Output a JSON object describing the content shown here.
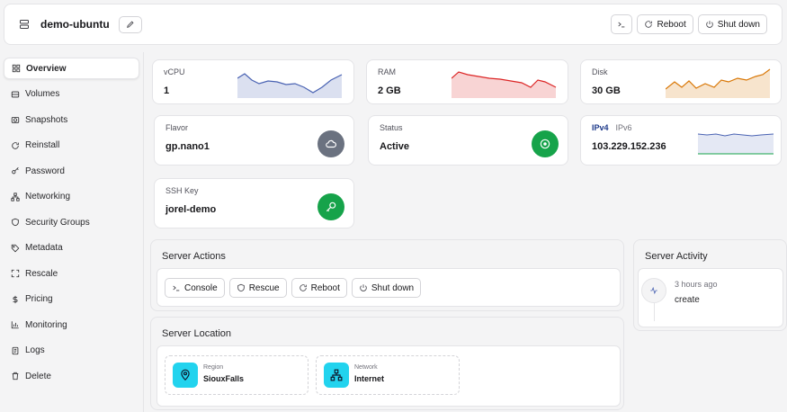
{
  "header": {
    "server_name": "demo-ubuntu",
    "reboot_label": "Reboot",
    "shutdown_label": "Shut down"
  },
  "sidebar": {
    "items": [
      {
        "label": "Overview",
        "icon": "grid-icon"
      },
      {
        "label": "Volumes",
        "icon": "disk-icon"
      },
      {
        "label": "Snapshots",
        "icon": "camera-icon"
      },
      {
        "label": "Reinstall",
        "icon": "refresh-icon"
      },
      {
        "label": "Password",
        "icon": "key-icon"
      },
      {
        "label": "Networking",
        "icon": "network-icon"
      },
      {
        "label": "Security Groups",
        "icon": "shield-icon"
      },
      {
        "label": "Metadata",
        "icon": "tag-icon"
      },
      {
        "label": "Rescale",
        "icon": "scale-icon"
      },
      {
        "label": "Pricing",
        "icon": "dollar-icon"
      },
      {
        "label": "Monitoring",
        "icon": "chart-icon"
      },
      {
        "label": "Logs",
        "icon": "log-icon"
      },
      {
        "label": "Delete",
        "icon": "trash-icon"
      }
    ]
  },
  "metrics": {
    "vcpu": {
      "label": "vCPU",
      "value": "1",
      "color": "#4a63b3"
    },
    "ram": {
      "label": "RAM",
      "value": "2 GB",
      "color": "#dc2626"
    },
    "disk": {
      "label": "Disk",
      "value": "30 GB",
      "color": "#d97706"
    }
  },
  "info": {
    "flavor": {
      "label": "Flavor",
      "value": "gp.nano1"
    },
    "status": {
      "label": "Status",
      "value": "Active"
    },
    "ip": {
      "tab_v4": "IPv4",
      "tab_v6": "IPv6",
      "value": "103.229.152.236"
    },
    "ssh": {
      "label": "SSH Key",
      "value": "jorel-demo"
    }
  },
  "actions": {
    "title": "Server Actions",
    "buttons": [
      "Console",
      "Rescue",
      "Reboot",
      "Shut down"
    ]
  },
  "location": {
    "title": "Server Location",
    "region_label": "Region",
    "region_value": "SiouxFalls",
    "network_label": "Network",
    "network_value": "Internet"
  },
  "activity": {
    "title": "Server Activity",
    "time": "3 hours ago",
    "event": "create"
  },
  "colors": {
    "active_green": "#16a34a",
    "flavor_gray": "#6b7280",
    "location_cyan": "#22d3ee"
  }
}
